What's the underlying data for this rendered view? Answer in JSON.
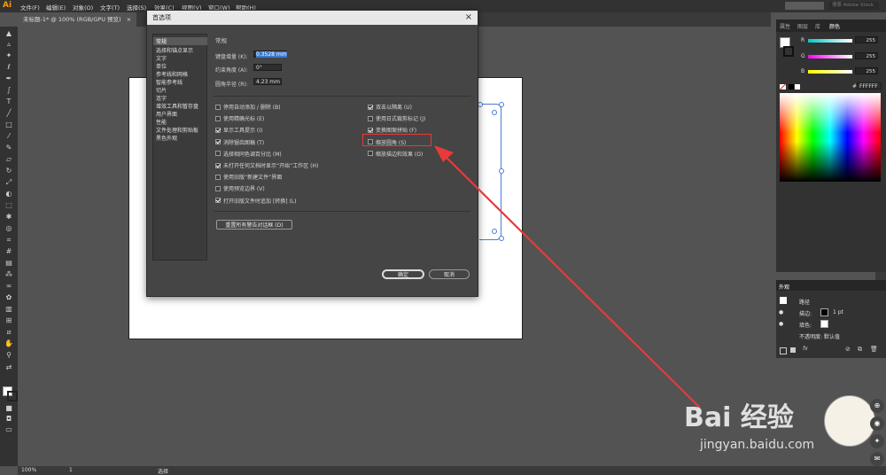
{
  "app": {
    "logo": "Ai",
    "menus": [
      "文件(F)",
      "编辑(E)",
      "对象(O)",
      "文字(T)",
      "选择(S)",
      "效果(C)",
      "视图(V)",
      "窗口(W)",
      "帮助(H)"
    ],
    "search_placeholder": "搜索 Adobe Stock"
  },
  "document_tab": {
    "label": "未标题-1* @ 100% (RGB/GPU 预览)",
    "close": "×"
  },
  "right_panel": {
    "tabs": [
      "属性",
      "图层",
      "库",
      "颜色"
    ],
    "active_tab": "颜色",
    "sliders": [
      {
        "label": "R",
        "value": "255",
        "colors": [
          "#00c8c8",
          "#ffffff"
        ]
      },
      {
        "label": "G",
        "value": "255",
        "colors": [
          "#ff00ff",
          "#ffffff"
        ]
      },
      {
        "label": "B",
        "value": "255",
        "colors": [
          "#ffff00",
          "#ffffff"
        ]
      }
    ],
    "hex_prefix": "#",
    "hex_value": "FFFFFF"
  },
  "appearance_panel": {
    "title": "外观",
    "rows": [
      {
        "label": "路径"
      },
      {
        "label": "描边:",
        "value": "1 pt"
      },
      {
        "label": "填色:"
      },
      {
        "label": "不透明度: 默认值"
      }
    ],
    "fx": "fx"
  },
  "status": {
    "zoom": "100%",
    "artboard": "1",
    "tool": "选择"
  },
  "dialog": {
    "title": "首选项",
    "categories": [
      "常规",
      "选择和锚点显示",
      "文字",
      "单位",
      "参考线和网格",
      "智能参考线",
      "切片",
      "连字",
      "增效工具和暂存盘",
      "用户界面",
      "性能",
      "文件处理和剪贴板",
      "黑色外观"
    ],
    "selected_category": "常规",
    "section_title": "常规",
    "fields": [
      {
        "label": "键盘增量 (K):",
        "value": "0.3528 mm"
      },
      {
        "label": "约束角度 (A):",
        "value": "0°"
      },
      {
        "label": "圆角半径 (R):",
        "value": "4.23 mm"
      }
    ],
    "left_options": [
      {
        "label": "停用自动添加 / 删除 (B)",
        "checked": false
      },
      {
        "label": "使用精确光标 (E)",
        "checked": false
      },
      {
        "label": "显示工具提示 (I)",
        "checked": true
      },
      {
        "label": "消除锯齿图稿 (T)",
        "checked": true
      },
      {
        "label": "选择相同色调百分比 (M)",
        "checked": false
      },
      {
        "label": "未打开任何文档时显示“开始”工作区 (H)",
        "checked": true
      },
      {
        "label": "使用旧版“新建文件”界面",
        "checked": false
      },
      {
        "label": "使用预览边界 (V)",
        "checked": false
      },
      {
        "label": "打开旧版文件时追加 [转换] (L)",
        "checked": true
      }
    ],
    "right_options": [
      {
        "label": "双击以隔离 (U)",
        "checked": true
      },
      {
        "label": "使用日式裁剪标记 (J)",
        "checked": false
      },
      {
        "label": "变换图案拼贴 (F)",
        "checked": true
      },
      {
        "label": "缩放圆角 (S)",
        "checked": false
      },
      {
        "label": "缩放描边和效果 (O)",
        "checked": false
      }
    ],
    "reset_warnings": "重置所有警告对话框 (D)",
    "ok": "确定",
    "cancel": "取消"
  },
  "annotation": {
    "color": "#e83a3a"
  },
  "watermark": {
    "brand": "Bai 经验",
    "url": "jingyan.baidu.com"
  }
}
